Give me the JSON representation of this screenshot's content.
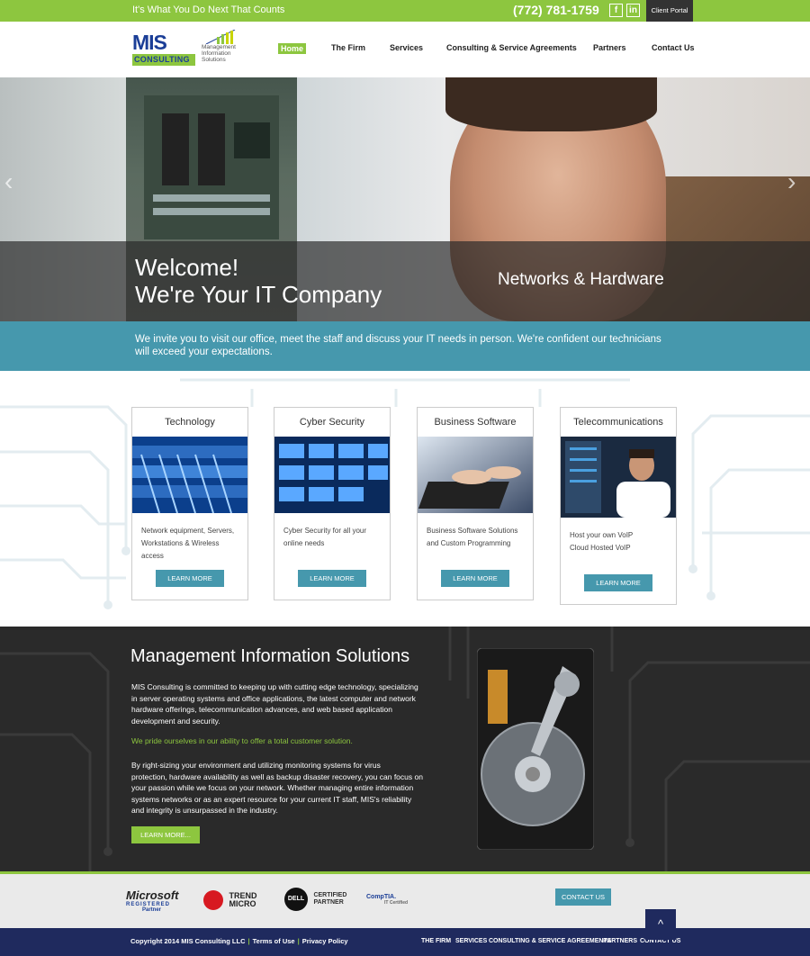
{
  "topbar": {
    "tagline": "It's What You Do Next That Counts",
    "phone": "(772) 781-1759",
    "facebook_glyph": "f",
    "linkedin_glyph": "in",
    "client_portal": "Client Portal"
  },
  "logo": {
    "mis": "MIS",
    "consulting": "CONSULTING",
    "sub_1": "Management",
    "sub_2": "Information",
    "sub_3": "Solutions"
  },
  "nav": {
    "items": [
      "Home",
      "The Firm",
      "Services",
      "Consulting & Service Agreements",
      "Partners",
      "Contact Us"
    ]
  },
  "hero": {
    "title_1": "Welcome!",
    "title_2": "We're Your IT Company",
    "subtitle": "Networks & Hardware",
    "prev": "‹",
    "next": "›"
  },
  "band": {
    "text": "We invite you to visit our office, meet the staff and discuss your IT needs in person. We're confident our technicians will exceed your expectations."
  },
  "services": {
    "cards": [
      {
        "title": "Technology",
        "text_1": "Network equipment, Servers,",
        "text_2": "Workstations & Wireless",
        "text_3": "access",
        "button": "LEARN MORE"
      },
      {
        "title": "Cyber Security",
        "text_1": "Cyber Security for all your",
        "text_2": "online needs",
        "text_3": "",
        "button": "LEARN MORE"
      },
      {
        "title": "Business Software",
        "text_1": "Business Software Solutions",
        "text_2": "and Custom Programming",
        "text_3": "",
        "button": "LEARN MORE"
      },
      {
        "title": "Telecommunications",
        "text_1": "Host your own VoIP",
        "text_2": "Cloud Hosted VoIP",
        "text_3": "",
        "button": "LEARN MORE"
      }
    ]
  },
  "about": {
    "title": "Management Information Solutions",
    "p1_1": "MIS Consulting is committed to keeping up with cutting edge technology, specializing",
    "p1_2": "in server operating systems and office applications, the latest computer and network",
    "p1_3": "hardware offerings, telecommunication advances, and web based application",
    "p1_4": "development and security.",
    "highlight": "We pride ourselves in our ability to offer a total customer solution.",
    "p2_1": "By right-sizing your environment and utilizing monitoring systems for virus",
    "p2_2": "protection, hardware availability as well as backup disaster recovery, you can focus on",
    "p2_3": "your passion while we focus on your network. Whether managing entire information",
    "p2_4": "systems networks or as an expert resource for your current IT staff, MIS's reliability",
    "p2_5": "and integrity is unsurpassed in the industry.",
    "button": "LEARN MORE..."
  },
  "partners": {
    "microsoft": "Microsoft",
    "microsoft_sub": "REGISTERED",
    "microsoft_sub2": "Partner",
    "trend_1": "TREND",
    "trend_2": "MICRO",
    "dell_mark": "DELL",
    "dell_1": "CERTIFIED",
    "dell_2": "PARTNER",
    "comptia": "CompTIA.",
    "comptia_sub": "IT Certified",
    "contact_button": "CONTACT US"
  },
  "footer": {
    "copyright": "Copyright 2014 MIS Consulting LLC",
    "terms": "Terms of Use",
    "privacy": "Privacy Policy",
    "nav": [
      "THE FIRM",
      "SERVICES",
      "CONSULTING & SERVICE AGREEMENTS",
      "PARTNERS",
      "CONTACT US"
    ],
    "to_top": "^"
  },
  "colors": {
    "accent_green": "#8dc63f",
    "teal": "#4698ad",
    "navy": "#1f2a5e",
    "brand_blue": "#1b3e97"
  }
}
